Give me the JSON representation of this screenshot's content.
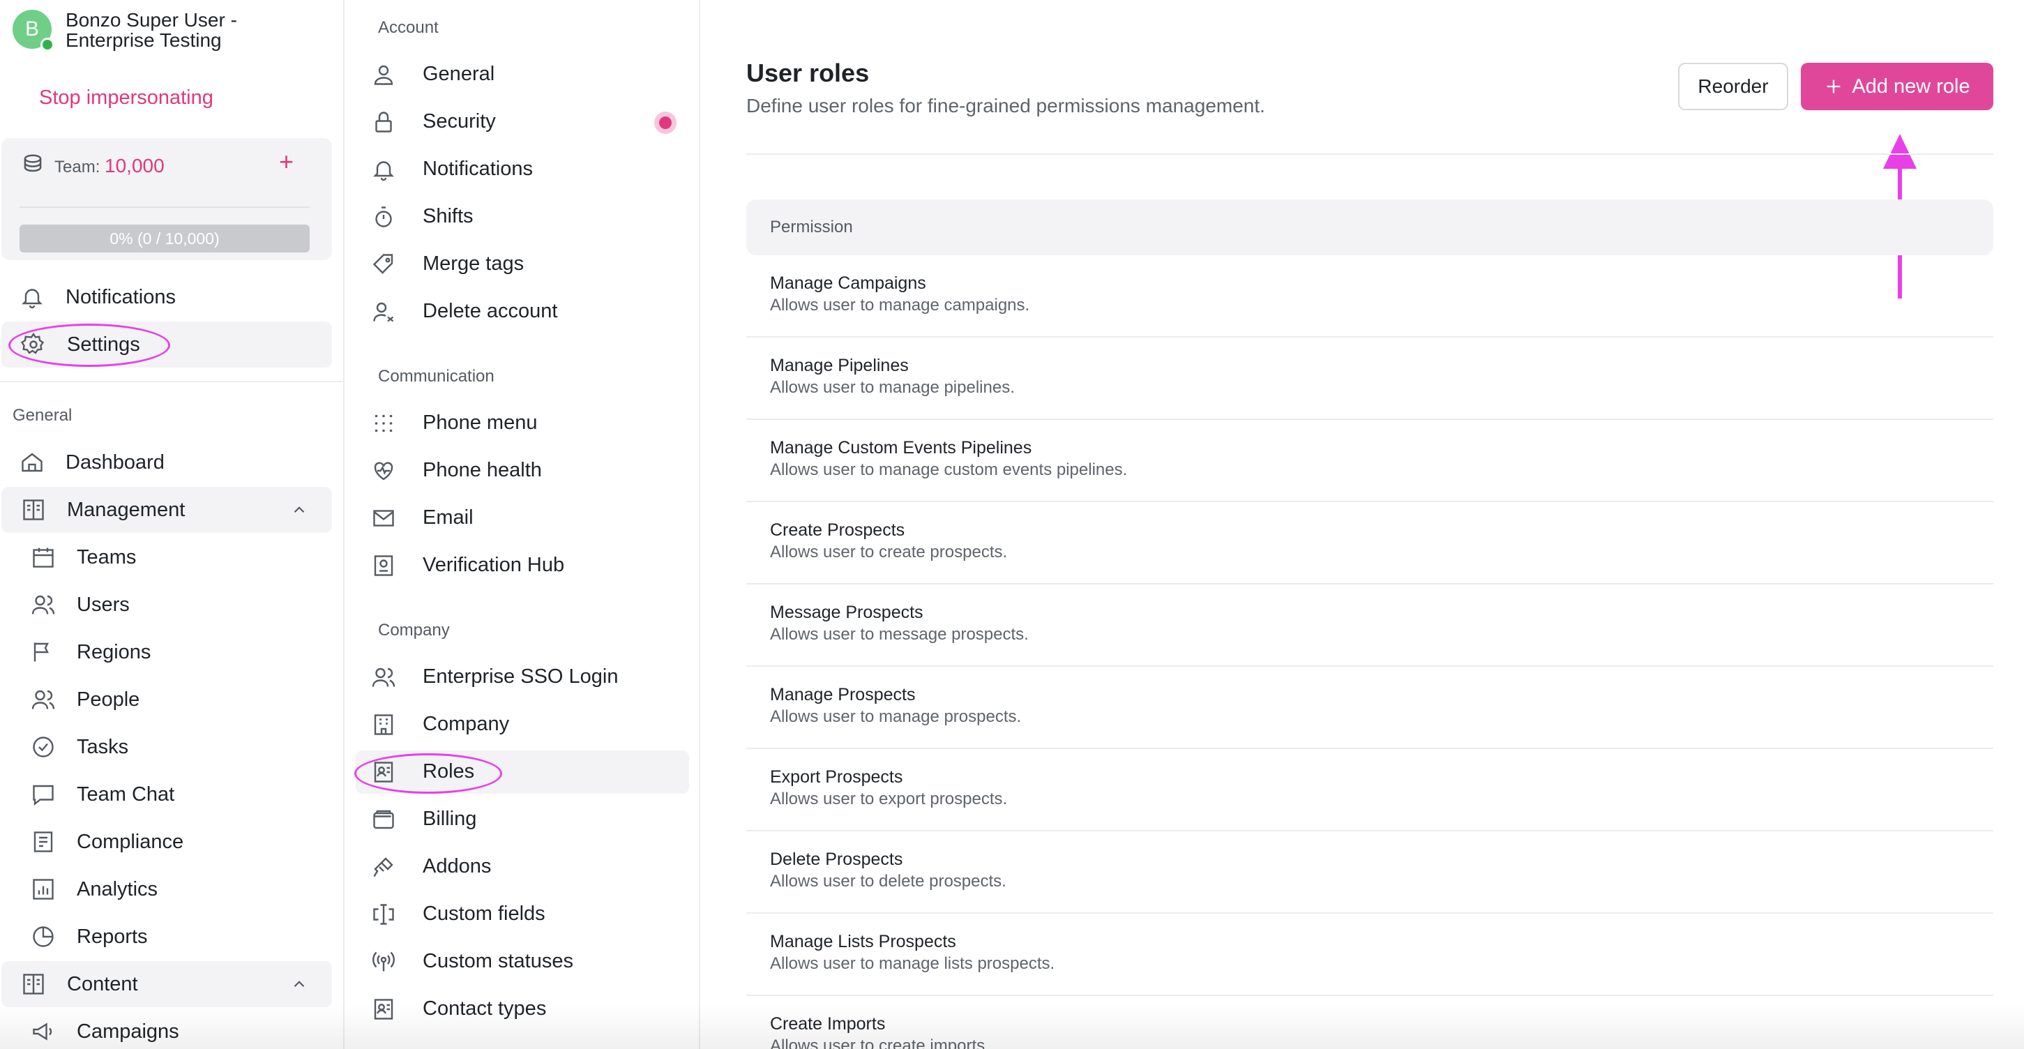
{
  "user": {
    "avatar_initial": "B",
    "name_line1": "Bonzo Super User -",
    "name_line2": "Enterprise Testing"
  },
  "stop_impersonating": "Stop impersonating",
  "team": {
    "label": "Team:",
    "value": "10,000",
    "progress_text": "0% (0 / 10,000)",
    "progress_fraction": 0
  },
  "sidebar": {
    "top_items": [
      {
        "label": "Notifications",
        "icon": "bell-icon"
      },
      {
        "label": "Settings",
        "icon": "gear-icon"
      }
    ],
    "general_label": "General",
    "dashboard": "Dashboard",
    "management": "Management",
    "management_items": [
      "Teams",
      "Users",
      "Regions",
      "People",
      "Tasks",
      "Team Chat",
      "Compliance",
      "Analytics",
      "Reports"
    ],
    "content": "Content",
    "content_items": [
      "Campaigns"
    ]
  },
  "settings_nav": {
    "account_label": "Account",
    "account": [
      "General",
      "Security",
      "Notifications",
      "Shifts",
      "Merge tags",
      "Delete account"
    ],
    "communication_label": "Communication",
    "communication": [
      "Phone menu",
      "Phone health",
      "Email",
      "Verification Hub"
    ],
    "company_label": "Company",
    "company": [
      "Enterprise SSO Login",
      "Company",
      "Roles",
      "Billing",
      "Addons",
      "Custom fields",
      "Custom statuses",
      "Contact types"
    ]
  },
  "main": {
    "title": "User roles",
    "subtitle": "Define user roles for fine-grained permissions management.",
    "reorder_label": "Reorder",
    "add_role_label": "Add new role",
    "table_header": "Permission",
    "permissions": [
      {
        "title": "Manage Campaigns",
        "desc": "Allows user to manage campaigns."
      },
      {
        "title": "Manage Pipelines",
        "desc": "Allows user to manage pipelines."
      },
      {
        "title": "Manage Custom Events Pipelines",
        "desc": "Allows user to manage custom events pipelines."
      },
      {
        "title": "Create Prospects",
        "desc": "Allows user to create prospects."
      },
      {
        "title": "Message Prospects",
        "desc": "Allows user to message prospects."
      },
      {
        "title": "Manage Prospects",
        "desc": "Allows user to manage prospects."
      },
      {
        "title": "Export Prospects",
        "desc": "Allows user to export prospects."
      },
      {
        "title": "Delete Prospects",
        "desc": "Allows user to delete prospects."
      },
      {
        "title": "Manage Lists Prospects",
        "desc": "Allows user to manage lists prospects."
      },
      {
        "title": "Create Imports",
        "desc": "Allows user to create imports."
      }
    ]
  },
  "colors": {
    "accent": "#e0387e",
    "button": "#e0479a",
    "annotation": "#e840e8"
  }
}
